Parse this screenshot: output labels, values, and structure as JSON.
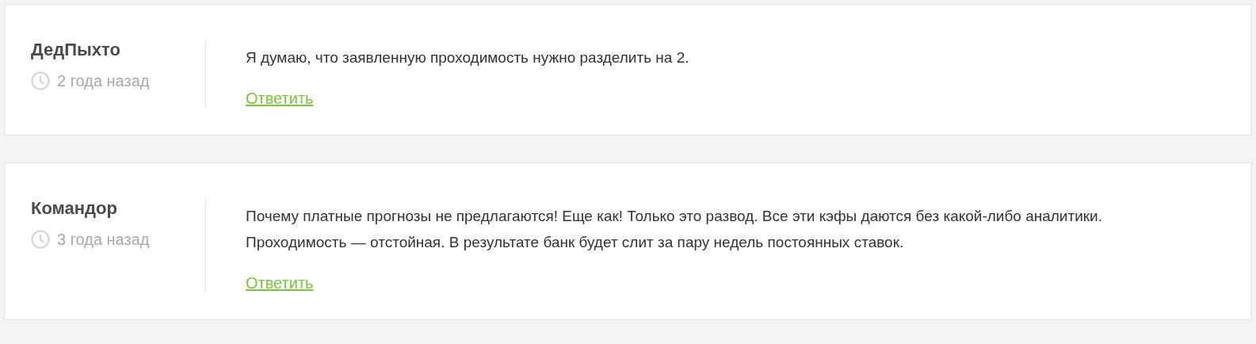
{
  "comments": [
    {
      "author": "ДедПыхто",
      "time": "2 года назад",
      "text": "Я думаю, что заявленную проходимость нужно разделить на 2.",
      "reply": "Ответить"
    },
    {
      "author": "Командор",
      "time": "3 года назад",
      "text": "Почему платные прогнозы не предлагаются! Еще как! Только это развод. Все эти кэфы даются без какой-либо аналитики. Проходимость — отстойная. В результате банк будет слит за пару недель постоянных ставок.",
      "reply": "Ответить"
    }
  ]
}
